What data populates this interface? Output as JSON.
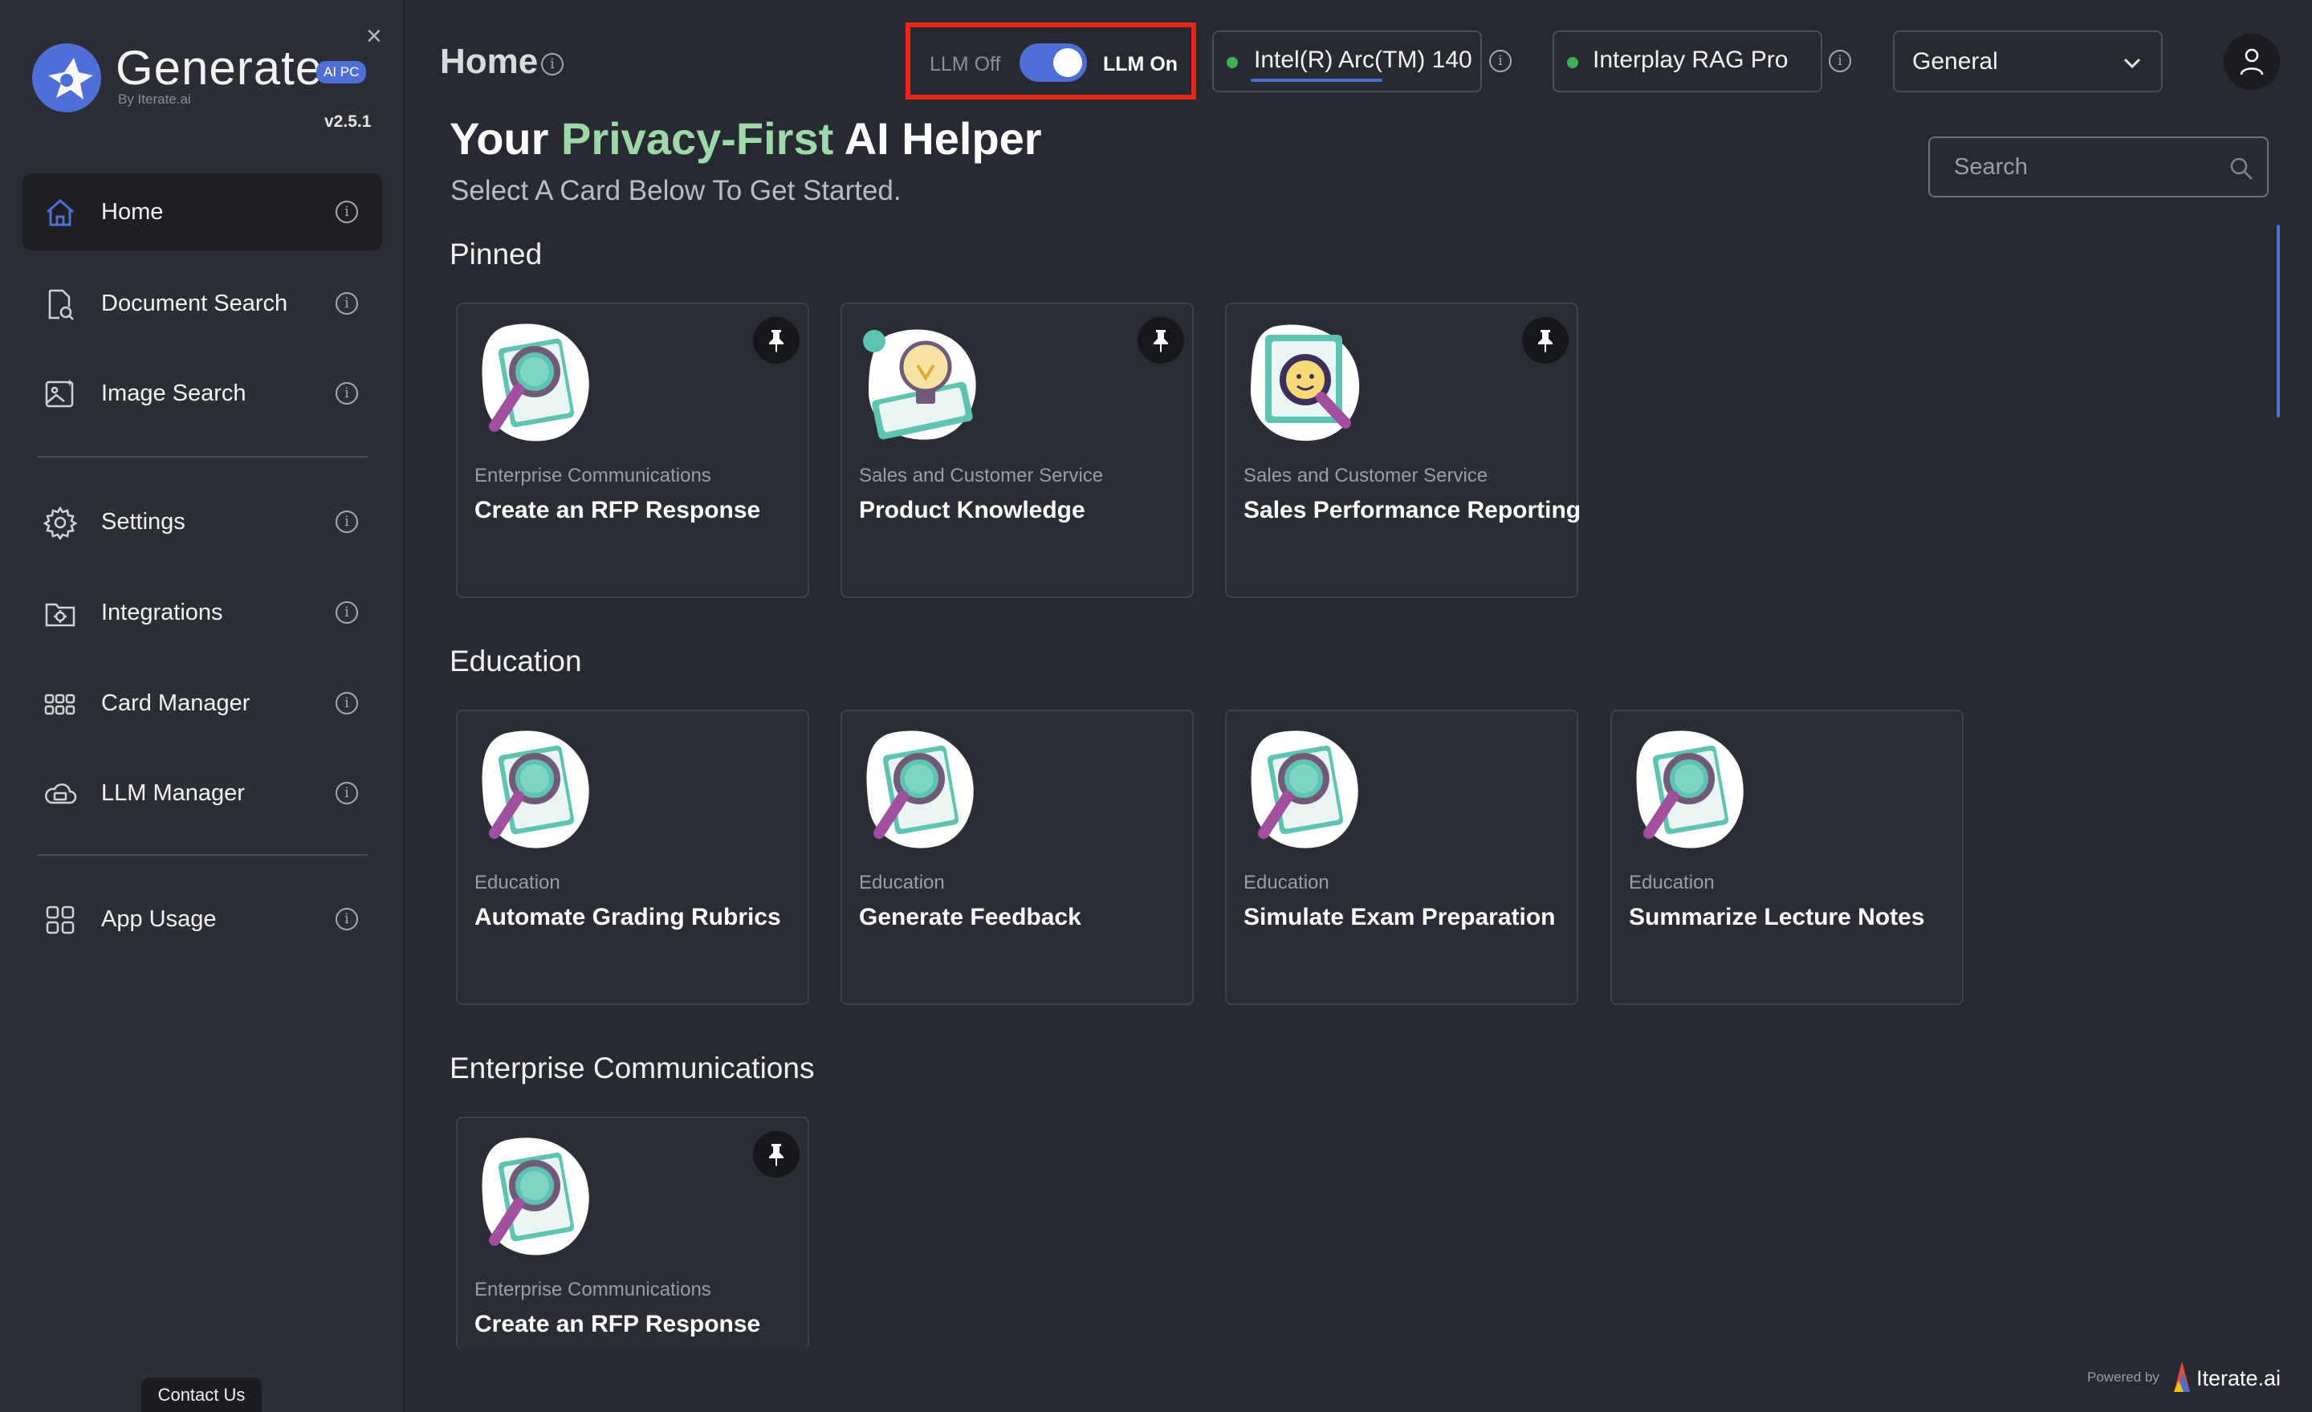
{
  "sidebar": {
    "brand": "Generate",
    "badge": "AI PC",
    "by": "By Iterate.ai",
    "version": "v2.5.1",
    "close": "×",
    "items": [
      {
        "label": "Home",
        "icon": "home-icon"
      },
      {
        "label": "Document Search",
        "icon": "document-search-icon"
      },
      {
        "label": "Image Search",
        "icon": "image-search-icon"
      },
      {
        "label": "Settings",
        "icon": "gear-icon"
      },
      {
        "label": "Integrations",
        "icon": "integrations-icon"
      },
      {
        "label": "Card Manager",
        "icon": "grid-dots-icon"
      },
      {
        "label": "LLM Manager",
        "icon": "cloud-icon"
      },
      {
        "label": "App Usage",
        "icon": "apps-icon"
      }
    ],
    "contact": "Contact Us"
  },
  "header": {
    "title": "Home",
    "llm_off": "LLM Off",
    "llm_on": "LLM On",
    "device": "Intel(R) Arc(TM) 140",
    "model": "Interplay RAG Pro",
    "mode": "General"
  },
  "hero": {
    "prefix": "Your",
    "accent": "Privacy-First",
    "suffix": "AI Helper",
    "subtitle": "Select A Card Below To Get Started.",
    "search_placeholder": "Search"
  },
  "sections": [
    {
      "title": "Pinned",
      "cards": [
        {
          "category": "Enterprise Communications",
          "title": "Create an RFP Response",
          "pinned": true
        },
        {
          "category": "Sales and Customer Service",
          "title": "Product Knowledge",
          "pinned": true
        },
        {
          "category": "Sales and Customer Service",
          "title": "Sales Performance Reporting",
          "pinned": true
        }
      ]
    },
    {
      "title": "Education",
      "cards": [
        {
          "category": "Education",
          "title": "Automate Grading Rubrics",
          "pinned": false
        },
        {
          "category": "Education",
          "title": "Generate Feedback",
          "pinned": false
        },
        {
          "category": "Education",
          "title": "Simulate Exam Preparation",
          "pinned": false
        },
        {
          "category": "Education",
          "title": "Summarize Lecture Notes",
          "pinned": false
        }
      ]
    },
    {
      "title": "Enterprise Communications",
      "cards": [
        {
          "category": "Enterprise Communications",
          "title": "Create an RFP Response",
          "pinned": true
        }
      ]
    }
  ],
  "footer": {
    "powered_by": "Powered by",
    "brand": "Iterate.ai"
  },
  "colors": {
    "accent_blue": "#4f6fd6",
    "accent_green": "#9fd8a8",
    "highlight_red": "#e8261d",
    "status_green": "#3fae56"
  }
}
